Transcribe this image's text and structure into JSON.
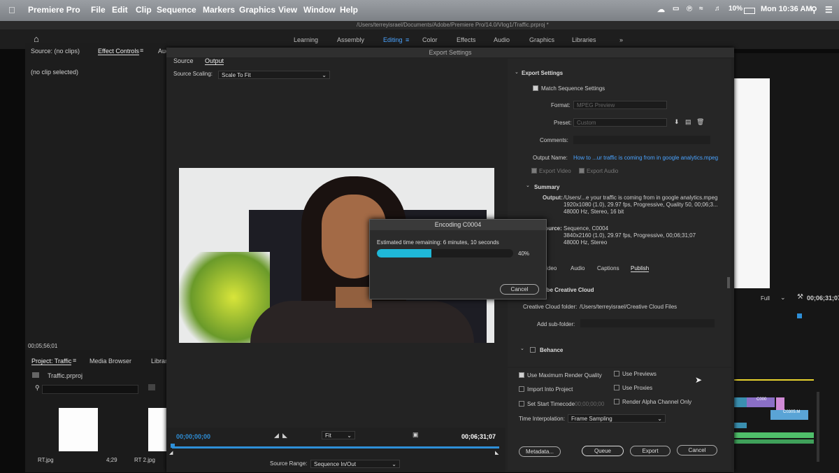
{
  "menubar": {
    "app": "Premiere Pro",
    "items": [
      "File",
      "Edit",
      "Clip",
      "Sequence",
      "Markers",
      "Graphics",
      "View",
      "Window",
      "Help"
    ],
    "battery": "10%",
    "clock": "Mon 10:36 AM"
  },
  "project_path": "/Users/terreyisrael/Documents/Adobe/Premiere Pro/14.0/Vlog1/Traffic.prproj *",
  "workspaces": [
    "Learning",
    "Assembly",
    "Editing",
    "Color",
    "Effects",
    "Audio",
    "Graphics",
    "Libraries"
  ],
  "workspaces_more": "»",
  "left_panel": {
    "tab_source": "Source: (no clips)",
    "tab_effect_controls": "Effect Controls",
    "tab_audio": "Aud",
    "no_clip": "(no clip selected)",
    "timecode": "00;05;56;01"
  },
  "project_panel": {
    "tab_project": "Project: Traffic",
    "tab_media": "Media Browser",
    "tab_libraries": "Librar",
    "file": "Traffic.prproj",
    "thumb1_label": "RT.jpg",
    "thumb1_dur": "4;29",
    "thumb2_label": "RT 2.jpg"
  },
  "right_panel": {
    "zoom": "Full",
    "timecode": "00;06;31;07",
    "clip1": "C000",
    "clip2": "C0305.M"
  },
  "export": {
    "title": "Export Settings",
    "tab_source": "Source",
    "tab_output": "Output",
    "source_scaling_label": "Source Scaling:",
    "source_scaling_value": "Scale To Fit",
    "settings_header": "Export Settings",
    "match_sequence": "Match Sequence Settings",
    "format_label": "Format:",
    "format_value": "MPEG Preview",
    "preset_label": "Preset:",
    "preset_value": "Custom",
    "comments_label": "Comments:",
    "output_name_label": "Output Name:",
    "output_name_value": "How to ...ur traffic is coming from in google analytics.mpeg",
    "export_video": "Export Video",
    "export_audio": "Export Audio",
    "summary_header": "Summary",
    "summary_output_label": "Output:",
    "summary_output_lines": [
      "/Users/...e your traffic is coming from in google analytics.mpeg",
      "1920x1080 (1.0), 29.97 fps, Progressive, Quality 50, 00;06;3...",
      "48000 Hz, Stereo, 16 bit"
    ],
    "summary_source_label": "Source:",
    "summary_source_lines": [
      "Sequence, C0004",
      "3840x2160 (1.0), 29.97 fps, Progressive, 00;06;31;07",
      "48000 Hz, Stereo"
    ],
    "tabs": [
      "Video",
      "Audio",
      "Captions",
      "Publish"
    ],
    "adobe_cc": "Adobe Creative Cloud",
    "cc_folder_label": "Creative Cloud folder:",
    "cc_folder_value": "/Users/terreyisrael/Creative Cloud Files",
    "sub_folder_label": "Add sub-folder:",
    "behance": "Behance",
    "use_max_render": "Use Maximum Render Quality",
    "use_previews": "Use Previews",
    "import_into_project": "Import Into Project",
    "use_proxies": "Use Proxies",
    "set_start_timecode": "Set Start Timecode",
    "start_timecode_value": "00;00;00;00",
    "render_alpha": "Render Alpha Channel Only",
    "time_interp_label": "Time Interpolation:",
    "time_interp_value": "Frame Sampling",
    "btn_metadata": "Metadata...",
    "btn_queue": "Queue",
    "btn_export": "Export",
    "btn_cancel": "Cancel",
    "timecode_in": "00;00;00;00",
    "timecode_out": "00;06;31;07",
    "fit": "Fit",
    "source_range_label": "Source Range:",
    "source_range_value": "Sequence In/Out"
  },
  "encoding": {
    "title": "Encoding C0004",
    "estimate": "Estimated time remaining: 6 minutes, 10 seconds",
    "percent_label": "40%",
    "progress_fraction": 0.4,
    "cancel": "Cancel"
  },
  "colors": {
    "accent_blue": "#2e8fd8",
    "progress_cyan": "#1fb8d8"
  }
}
